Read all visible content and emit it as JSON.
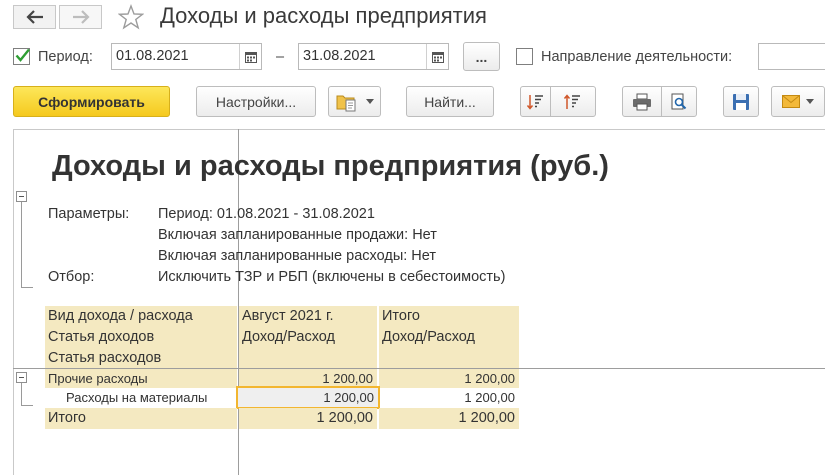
{
  "window": {
    "title": "Доходы и расходы предприятия"
  },
  "filter": {
    "period_label": "Период:",
    "period_checked": true,
    "date_from": "01.08.2021",
    "dash": "–",
    "date_to": "31.08.2021",
    "choose_label": "...",
    "activity_label": "Направление деятельности:",
    "activity_value": ""
  },
  "toolbar": {
    "generate_label": "Сформировать",
    "settings_label": "Настройки...",
    "find_label": "Найти..."
  },
  "report": {
    "title": "Доходы и расходы предприятия (руб.)",
    "params_label": "Параметры:",
    "params": [
      "Период: 01.08.2021 - 31.08.2021",
      "Включая запланированные продажи: Нет",
      "Включая запланированные расходы: Нет"
    ],
    "filter_label": "Отбор:",
    "filter_value": "Исключить ТЗР и РБП (включены в себестоимость)",
    "header": {
      "col1": [
        "Вид дохода / расхода",
        "Статья доходов",
        "Статья расходов"
      ],
      "col2": [
        "Август 2021 г.",
        "Доход/Расход"
      ],
      "col3": [
        "Итого",
        "Доход/Расход"
      ]
    },
    "rows": [
      {
        "name": "Прочие расходы",
        "aug": "1 200,00",
        "total": "1 200,00"
      },
      {
        "name": "Расходы на материалы",
        "aug": "1 200,00",
        "total": "1 200,00"
      }
    ],
    "total_row": {
      "name": "Итого",
      "aug": "1 200,00",
      "total": "1 200,00"
    }
  },
  "colors": {
    "accent_yellow": "#f5c91e",
    "header_bg": "#f4e9c1",
    "selection_border": "#f2b630",
    "check_green": "#2e9e33"
  }
}
